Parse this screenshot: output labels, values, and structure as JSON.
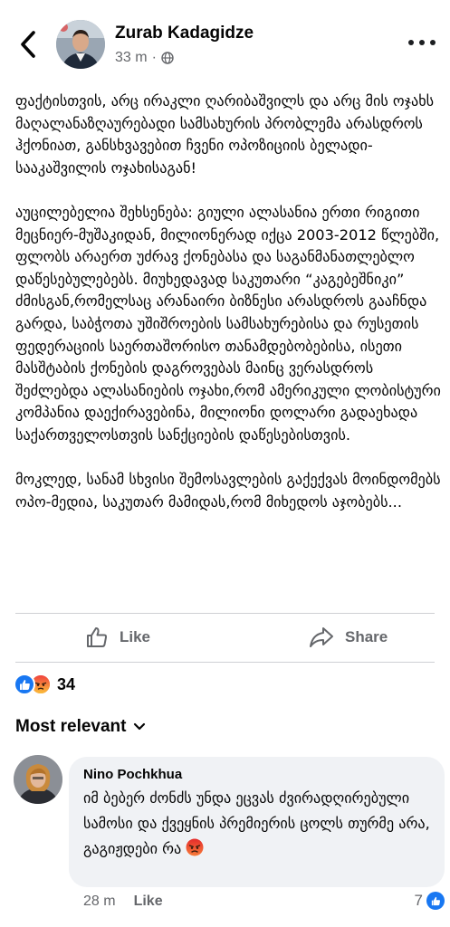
{
  "header": {
    "author": "Zurab Kadagidze",
    "time": "33 m",
    "separator": "·",
    "audience_icon": "globe-icon"
  },
  "post": {
    "paragraphs": [
      "ფაქტისთვის, არც ირაკლი ღარიბაშვილს და არც მის ოჯახს მაღალანაზღაურებადი სამსახურის პრობლემა არასდროს ჰქონიათ, განსხვავებით ჩვენი ოპოზიციის ბელადი-სააკაშვილის ოჯახისაგან!",
      "აუცილებელია შეხსენება: გიული ალასანია ერთი რიგითი მეცნიერ-მუშაკიდან, მილიონერად იქცა 2003-2012 წლებში,  ფლობს არაერთ უძრავ ქონებასა და საგანმანათლებლო დაწესებულებებს. მიუხედავად საკუთარი “კაგებეშნიკი” ძმისგან,რომელსაც არანაირი ბიზნესი არასდროს გააჩნდა გარდა, საბჭოთა უშიშროების სამსახურებისა და რუსეთის ფედერაციის საერთაშორისო თანამდებობებისა, ისეთი მასშტაბის ქონების დაგროვებას მაინც ვერასდროს შეძლებდა ალასანიების ოჯახი,რომ ამერიკული ლობისტური კომპანია დაექირავებინა, მილიონი დოლარი გადაეხადა საქართველოსთვის სანქციების დაწესებისთვის.",
      "მოკლედ, სანამ სხვისი შემოსავლების გაქექვას მოინდომებს ოპო-მედია, საკუთარ მამიდას,რომ მიხედოს აჯობებს..."
    ]
  },
  "actions": {
    "like_label": "Like",
    "share_label": "Share"
  },
  "reactions": {
    "icons": [
      "like-reaction-icon",
      "angry-reaction-icon"
    ],
    "count": "34"
  },
  "comments_sort": {
    "label": "Most relevant"
  },
  "comment": {
    "author": "Nino Pochkhua",
    "text": "იმ ბებერ ძონძს უნდა ეცვას ძვირადღირებული სამოსი და ქვეყნის პრემიერის ცოლს თურმე არა, გაგიჟდები რა",
    "emoji_icon": "angry-emoji-icon",
    "time": "28 m",
    "like_label": "Like",
    "reaction_count": "7"
  },
  "colors": {
    "text": "#050505",
    "secondary": "#65676b",
    "bubble": "#f0f2f5",
    "like_blue": "#1877f2",
    "angry_orange": "#f7714c"
  }
}
